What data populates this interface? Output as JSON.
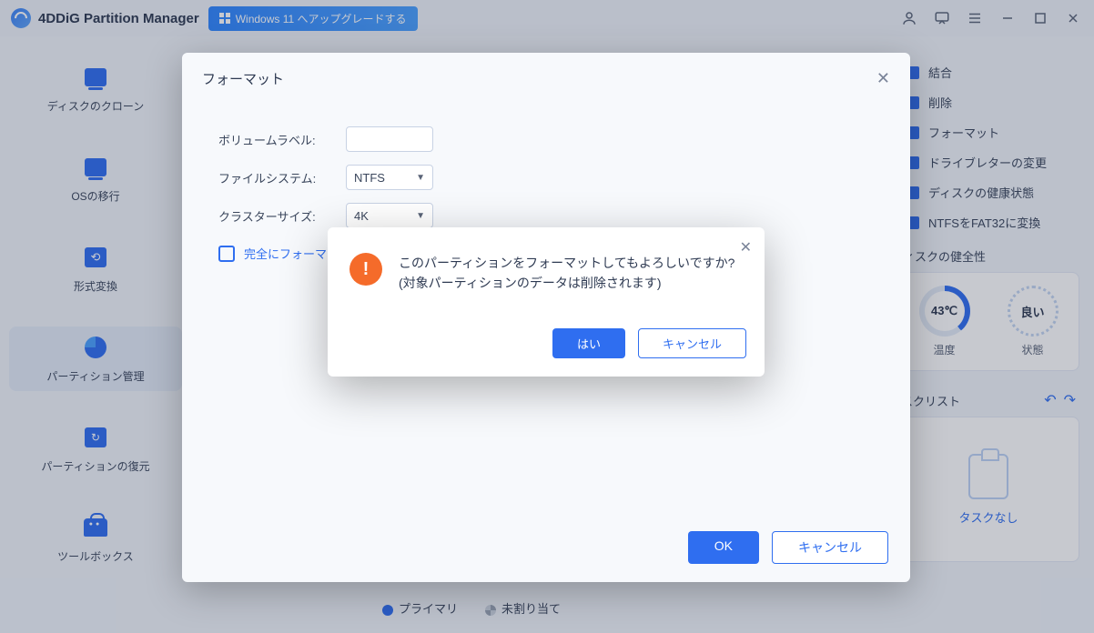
{
  "topbar": {
    "title": "4DDiG Partition Manager",
    "upgrade": "Windows 11 へアップグレードする"
  },
  "sidebar": {
    "items": [
      {
        "label": "ディスクのクローン"
      },
      {
        "label": "OSの移行"
      },
      {
        "label": "形式変換"
      },
      {
        "label": "パーティション管理"
      },
      {
        "label": "パーティションの復元"
      },
      {
        "label": "ツールボックス"
      }
    ]
  },
  "menu": {
    "items": [
      {
        "label": "結合"
      },
      {
        "label": "削除"
      },
      {
        "label": "フォーマット"
      },
      {
        "label": "ドライブレターの変更"
      },
      {
        "label": "ディスクの健康状態"
      },
      {
        "label": "NTFSをFAT32に変換"
      }
    ]
  },
  "health": {
    "title": "ィスクの健全性",
    "temp_value": "43℃",
    "temp_label": "温度",
    "status_value": "良い",
    "status_label": "状態"
  },
  "tasks": {
    "title": "スクリスト",
    "empty": "タスクなし"
  },
  "legend": {
    "primary": "プライマリ",
    "unallocated": "未割り当て"
  },
  "dialog": {
    "title": "フォーマット",
    "volume_label": "ボリュームラベル:",
    "filesystem_label": "ファイルシステム:",
    "filesystem_value": "NTFS",
    "cluster_label": "クラスターサイズ:",
    "cluster_value": "4K",
    "full_format": "完全にフォーマ",
    "ok": "OK",
    "cancel": "キャンセル"
  },
  "confirm": {
    "message": "このパーティションをフォーマットしてもよろしいですか? (対象パーティションのデータは削除されます)",
    "yes": "はい",
    "cancel": "キャンセル"
  }
}
